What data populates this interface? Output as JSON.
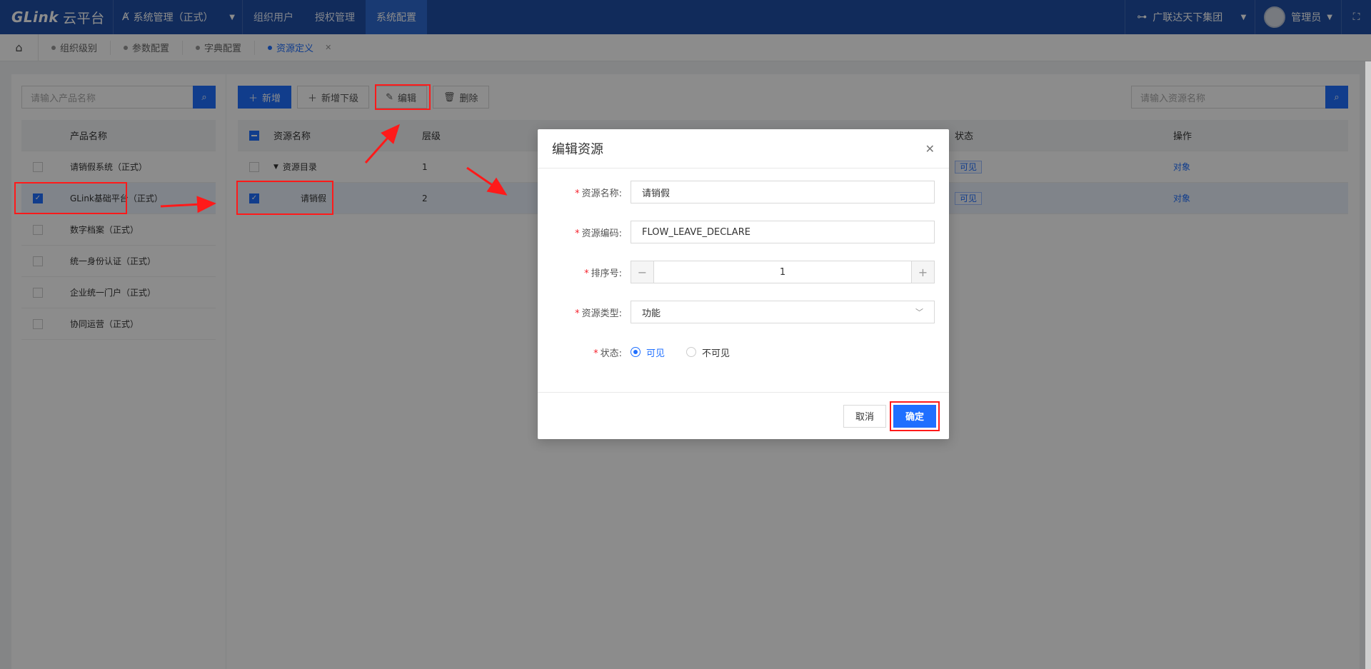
{
  "app": {
    "logo": "GLink",
    "logo_cn": "云平台"
  },
  "topbar": {
    "system": "系统管理（正式）",
    "nav": [
      "组织用户",
      "授权管理",
      "系统配置"
    ],
    "active_nav": "系统配置",
    "org": "广联达天下集团",
    "user": "管理员"
  },
  "tabs": {
    "items": [
      "组织级别",
      "参数配置",
      "字典配置",
      "资源定义"
    ],
    "active": "资源定义"
  },
  "left": {
    "search_placeholder": "请输入产品名称",
    "header": "产品名称",
    "products": [
      {
        "name": "请销假系统（正式）",
        "checked": false
      },
      {
        "name": "GLink基础平台（正式）",
        "checked": true
      },
      {
        "name": "数字档案（正式）",
        "checked": false
      },
      {
        "name": "统一身份认证（正式）",
        "checked": false
      },
      {
        "name": "企业统一门户（正式）",
        "checked": false
      },
      {
        "name": "协同运营（正式）",
        "checked": false
      }
    ]
  },
  "toolbar": {
    "add": "新增",
    "add_child": "新增下级",
    "edit": "编辑",
    "delete": "删除",
    "search_placeholder": "请输入资源名称"
  },
  "table": {
    "headers": {
      "name": "资源名称",
      "level": "层级",
      "status": "状态",
      "op": "操作"
    },
    "rows": [
      {
        "name": "资源目录",
        "level": "1",
        "status": "可见",
        "op": "对象"
      },
      {
        "name": "请销假",
        "level": "2",
        "status": "可见",
        "op": "对象"
      }
    ]
  },
  "modal": {
    "title": "编辑资源",
    "labels": {
      "name": "资源名称:",
      "code": "资源编码:",
      "order": "排序号:",
      "type": "资源类型:",
      "status": "状态:"
    },
    "values": {
      "name": "请销假",
      "code": "FLOW_LEAVE_DECLARE",
      "order": "1",
      "type": "功能"
    },
    "status_options": [
      "可见",
      "不可见"
    ],
    "status_selected": "可见",
    "cancel": "取消",
    "ok": "确定"
  },
  "colors": {
    "primary": "#1f6fff",
    "topbar": "#1f4fa6",
    "annotation": "#ff1a1a"
  }
}
